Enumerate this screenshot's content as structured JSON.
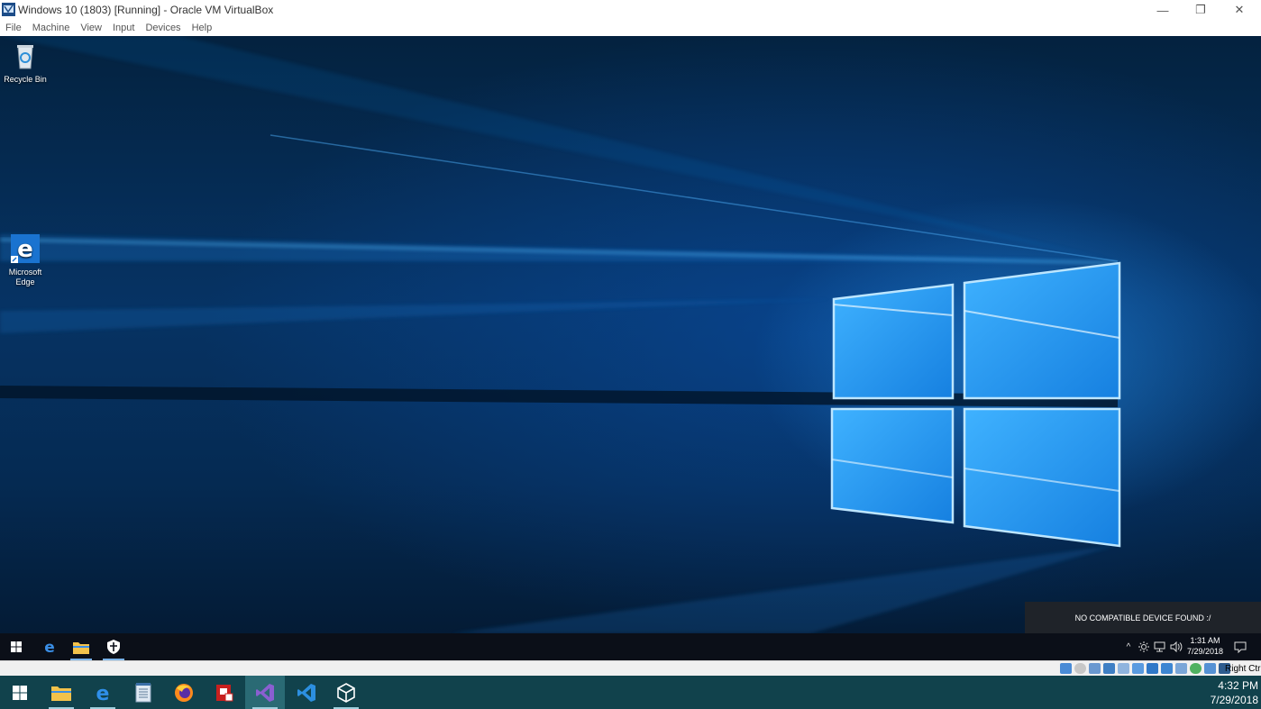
{
  "window": {
    "title": "Windows 10 (1803) [Running] - Oracle VM VirtualBox",
    "controls": {
      "minimize": "—",
      "restore": "❐",
      "close": "✕"
    }
  },
  "menu": {
    "items": [
      "File",
      "Machine",
      "View",
      "Input",
      "Devices",
      "Help"
    ]
  },
  "desktop": {
    "icons": [
      {
        "label": "Recycle Bin"
      },
      {
        "label": "Microsoft Edge"
      }
    ]
  },
  "notification": {
    "text": "NO COMPATIBLE DEVICE FOUND :/"
  },
  "vm_taskbar": {
    "tray_chevron": "^",
    "clock_time": "1:31 AM",
    "clock_date": "7/29/2018"
  },
  "statusbar": {
    "host_key": "Right Ctrl"
  },
  "host_taskbar": {
    "clock_time": "4:32 PM",
    "clock_date": "7/29/2018"
  },
  "colors": {
    "wallpaper_glow": "#2f9cf0",
    "taskbar_vm": "#0b0f18",
    "taskbar_host": "#11424c",
    "accent": "#7ab3ea"
  }
}
